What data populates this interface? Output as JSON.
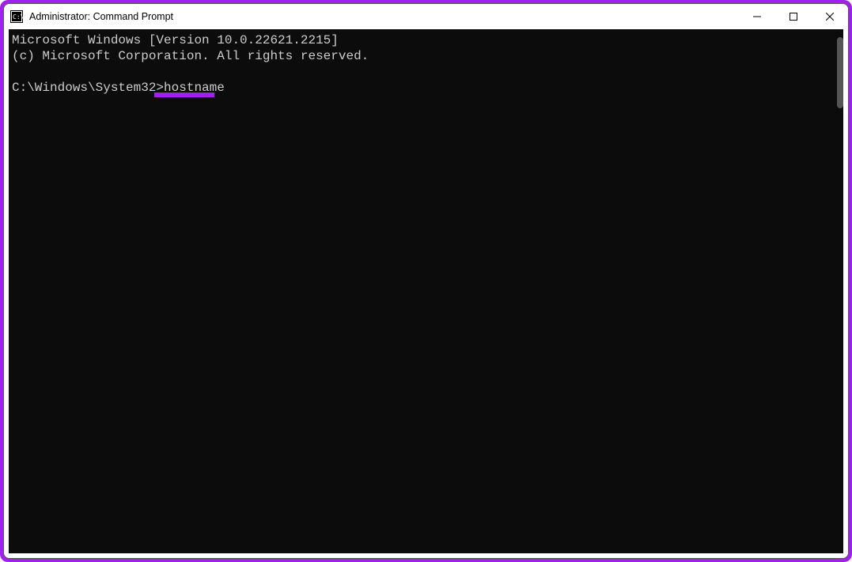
{
  "window": {
    "title": "Administrator: Command Prompt"
  },
  "terminal": {
    "line1": "Microsoft Windows [Version 10.0.22621.2215]",
    "line2": "(c) Microsoft Corporation. All rights reserved.",
    "prompt": "C:\\Windows\\System32>",
    "command": "hostname"
  },
  "colors": {
    "accent_border": "#a020f0",
    "terminal_bg": "#0c0c0c",
    "terminal_fg": "#cccccc"
  }
}
